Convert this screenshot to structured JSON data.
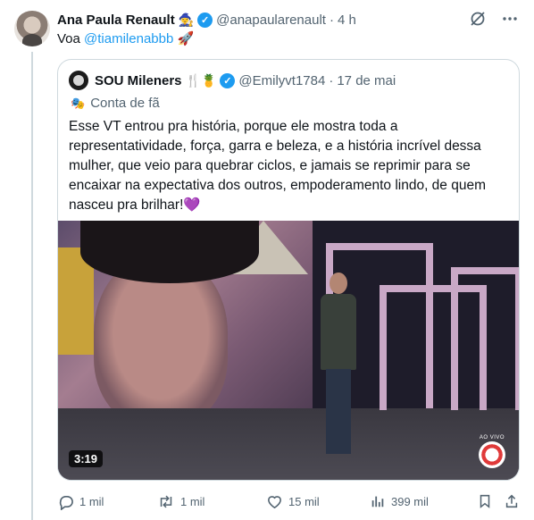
{
  "post": {
    "author_name": "Ana Paula Renault",
    "author_emoji": "🧙‍♀️",
    "handle": "@anapaularenault",
    "separator": "·",
    "time": "4 h",
    "text_prefix": "Voa ",
    "mention": "@tiamilenabbb",
    "text_emoji": "🚀"
  },
  "quote": {
    "author_name": "SOU Mileners",
    "author_emojis": "🍴🍍",
    "handle": "@Emilyvt1784",
    "separator": "·",
    "date": "17 de mai",
    "label": "Conta de fã",
    "body": "Esse VT entrou pra história, porque ele mostra toda a representatividade, força, garra e beleza, e a história incrível dessa mulher, que veio para quebrar ciclos, e jamais se reprimir para se encaixar na expectativa dos outros, empoderamento lindo, de quem nasceu pra brilhar!💜",
    "video": {
      "duration": "3:19",
      "live_label": "AO VIVO"
    }
  },
  "actions": {
    "replies": "1 mil",
    "reposts": "1 mil",
    "likes": "15 mil",
    "views": "399 mil"
  },
  "colors": {
    "accent": "#1d9bf0",
    "muted": "#536471",
    "border": "#cfd9de"
  },
  "icons": [
    "grok-icon",
    "more-icon",
    "verified-icon",
    "fan-mask-icon",
    "reply-icon",
    "repost-icon",
    "like-icon",
    "views-icon",
    "bookmark-icon",
    "share-icon"
  ]
}
